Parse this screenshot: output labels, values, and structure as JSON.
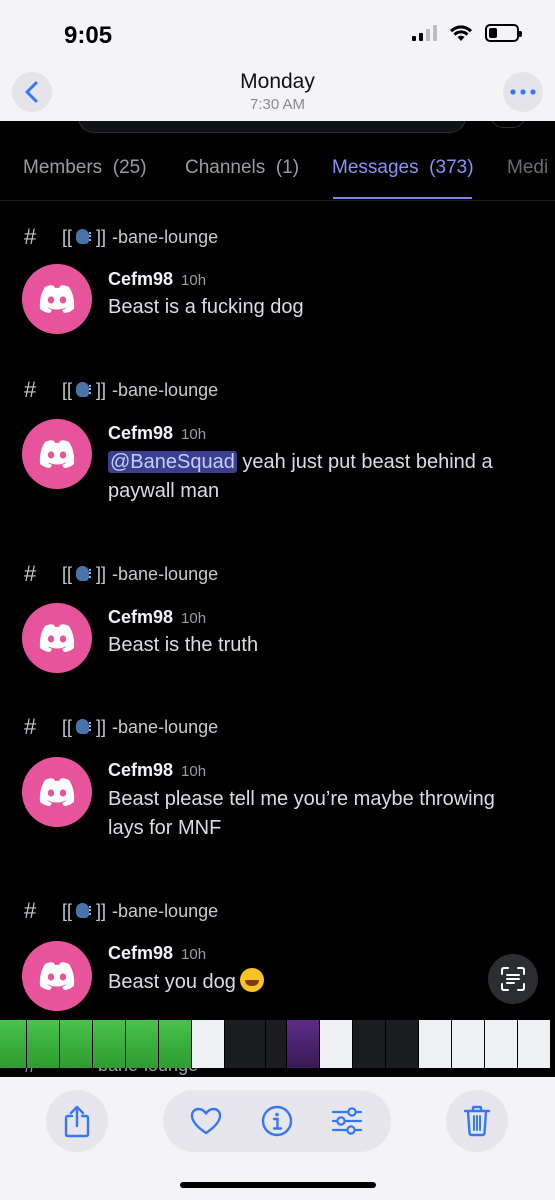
{
  "status_bar": {
    "time": "9:05"
  },
  "header": {
    "title": "Monday",
    "subtitle": "7:30 AM"
  },
  "tabs": [
    {
      "label": "Members",
      "count": "(25)"
    },
    {
      "label": "Channels",
      "count": "(1)"
    },
    {
      "label": "Messages",
      "count": "(373)"
    },
    {
      "label": "Medi",
      "count": ""
    }
  ],
  "results": [
    {
      "channel": "-bane-lounge",
      "user": "Cefm98",
      "time": "10h",
      "message": "Beast is a fucking dog"
    },
    {
      "channel": "-bane-lounge",
      "user": "Cefm98",
      "time": "10h",
      "mention": "@BaneSquad",
      "message": " yeah just put beast behind a paywall man"
    },
    {
      "channel": "-bane-lounge",
      "user": "Cefm98",
      "time": "10h",
      "message": "Beast is the truth"
    },
    {
      "channel": "-bane-lounge",
      "user": "Cefm98",
      "time": "10h",
      "message": "Beast please tell me you’re maybe throwing lays for MNF"
    },
    {
      "channel": "-bane-lounge",
      "user": "Cefm98",
      "time": "10h",
      "message": "Beast you dog",
      "emoji": "rofl-emoji"
    }
  ],
  "partial_channel": "-bane-lounge",
  "icons": {
    "back": "chevron-left-icon",
    "more": "ellipsis-icon",
    "share": "share-icon",
    "favorite": "heart-icon",
    "info": "info-icon",
    "adjust": "sliders-icon",
    "delete": "trash-icon",
    "live_text": "live-text-icon"
  },
  "colors": {
    "accent": "#7b83f2",
    "avatar": "#e8549b",
    "ios_blue": "#3478f6"
  }
}
